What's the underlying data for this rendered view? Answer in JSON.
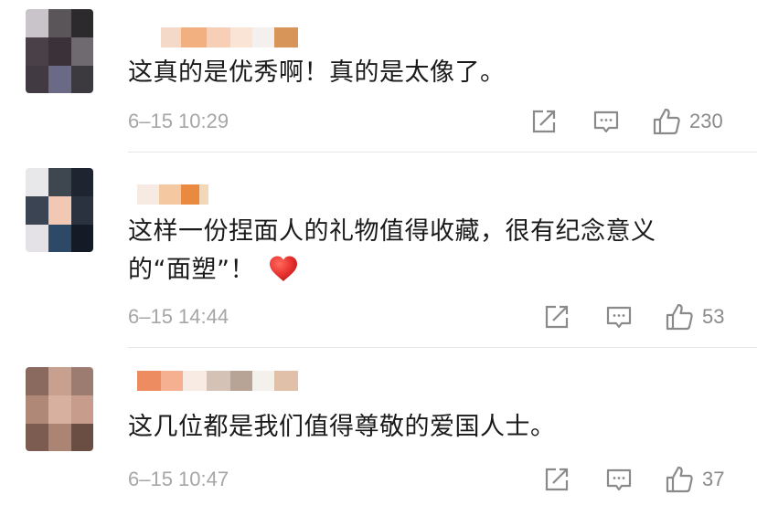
{
  "comments": [
    {
      "text": "这真的是优秀啊！真的是太像了。",
      "time": "6–15 10:29",
      "likes": "230",
      "icons": [
        "repost-icon",
        "comment-icon",
        "like-icon"
      ]
    },
    {
      "text_line1": "这样一份捏面人的礼物值得收藏，很有纪念意义",
      "text_line2": "的“面塑”！",
      "emoji": "red-heart",
      "time": "6–15 14:44",
      "likes": "53",
      "icons": [
        "repost-icon",
        "comment-icon",
        "like-icon"
      ]
    },
    {
      "text": "这几位都是我们值得尊敬的爱国人士。",
      "time": "6–15 10:47",
      "likes": "37",
      "icons": [
        "repost-icon",
        "comment-icon",
        "like-icon"
      ]
    }
  ],
  "colors": {
    "meta_text": "#a6a6a6",
    "icon_stroke": "#8a8a8a",
    "heart": "#e8312f",
    "divider": "#e6e6e6"
  }
}
